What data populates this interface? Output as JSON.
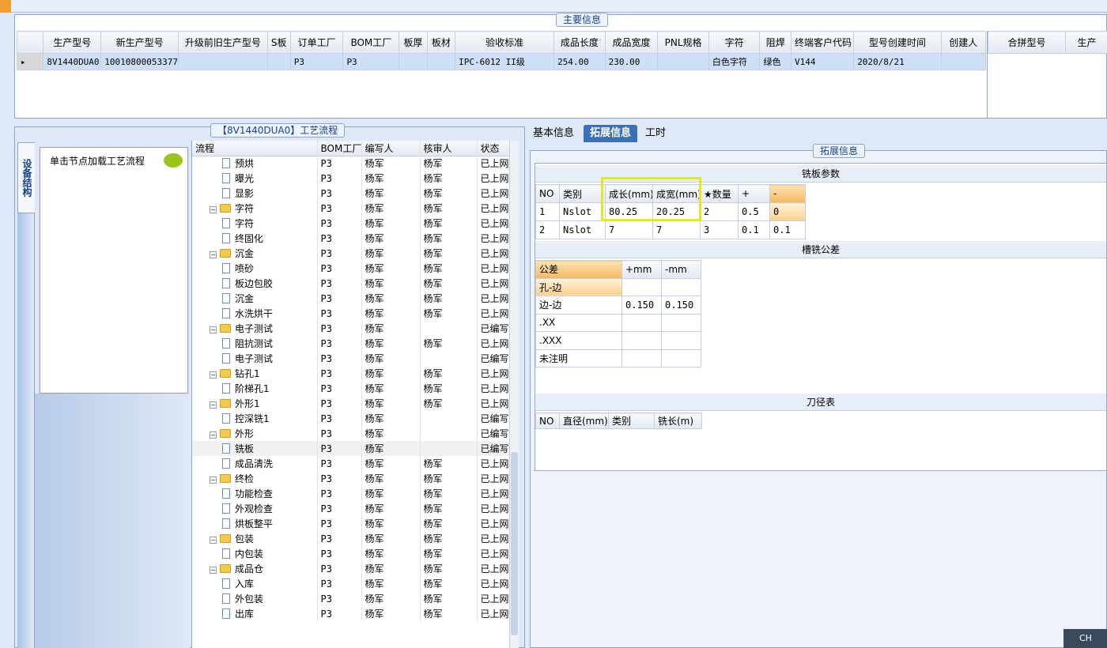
{
  "main_panel": {
    "title": "主要信息",
    "columns": [
      "生产型号",
      "新生产型号",
      "升级前旧生产型号",
      "S板",
      "订单工厂",
      "BOM工厂",
      "板厚",
      "板材",
      "验收标准",
      "成品长度",
      "成品宽度",
      "PNL规格",
      "字符",
      "阻焊",
      "终端客户代码",
      "型号创建时间",
      "创建人"
    ],
    "rows": [
      [
        "8V1440DUA0",
        "10010800053377",
        "",
        "",
        "P3",
        "P3",
        "",
        "",
        "IPC-6012 II级",
        "254.00",
        "230.00",
        "",
        "白色字符",
        "绿色",
        "V144",
        "2020/8/21",
        ""
      ]
    ],
    "combined_columns": [
      "合拼型号",
      "生产"
    ]
  },
  "left_panel": {
    "title": "【8V1440DUA0】工艺流程",
    "vertical_tab": "设备结构",
    "hint": "单击节点加载工艺流程",
    "columns": [
      "流程",
      "BOM工厂",
      "编写人",
      "核审人",
      "状态"
    ],
    "rows": [
      {
        "level": 1,
        "type": "doc",
        "name": "预烘",
        "bom": "P3",
        "writer": "杨军",
        "reviewer": "杨军",
        "status": "已上网"
      },
      {
        "level": 1,
        "type": "doc",
        "name": "曝光",
        "bom": "P3",
        "writer": "杨军",
        "reviewer": "杨军",
        "status": "已上网"
      },
      {
        "level": 1,
        "type": "doc",
        "name": "显影",
        "bom": "P3",
        "writer": "杨军",
        "reviewer": "杨军",
        "status": "已上网"
      },
      {
        "level": 0,
        "type": "folder",
        "name": "字符",
        "bom": "P3",
        "writer": "杨军",
        "reviewer": "杨军",
        "status": "已上网"
      },
      {
        "level": 1,
        "type": "doc",
        "name": "字符",
        "bom": "P3",
        "writer": "杨军",
        "reviewer": "杨军",
        "status": "已上网"
      },
      {
        "level": 1,
        "type": "doc",
        "name": "终固化",
        "bom": "P3",
        "writer": "杨军",
        "reviewer": "杨军",
        "status": "已上网"
      },
      {
        "level": 0,
        "type": "folder",
        "name": "沉金",
        "bom": "P3",
        "writer": "杨军",
        "reviewer": "杨军",
        "status": "已上网"
      },
      {
        "level": 1,
        "type": "doc",
        "name": "喷砂",
        "bom": "P3",
        "writer": "杨军",
        "reviewer": "杨军",
        "status": "已上网"
      },
      {
        "level": 1,
        "type": "doc",
        "name": "板边包胶",
        "bom": "P3",
        "writer": "杨军",
        "reviewer": "杨军",
        "status": "已上网"
      },
      {
        "level": 1,
        "type": "doc",
        "name": "沉金",
        "bom": "P3",
        "writer": "杨军",
        "reviewer": "杨军",
        "status": "已上网"
      },
      {
        "level": 1,
        "type": "doc",
        "name": "水洗烘干",
        "bom": "P3",
        "writer": "杨军",
        "reviewer": "杨军",
        "status": "已上网"
      },
      {
        "level": 0,
        "type": "folder",
        "name": "电子测试",
        "bom": "P3",
        "writer": "杨军",
        "reviewer": "",
        "status": "已编写"
      },
      {
        "level": 1,
        "type": "doc",
        "name": "阻抗测试",
        "bom": "P3",
        "writer": "杨军",
        "reviewer": "杨军",
        "status": "已上网"
      },
      {
        "level": 1,
        "type": "doc",
        "name": "电子测试",
        "bom": "P3",
        "writer": "杨军",
        "reviewer": "",
        "status": "已编写"
      },
      {
        "level": 0,
        "type": "folder",
        "name": "钻孔1",
        "bom": "P3",
        "writer": "杨军",
        "reviewer": "杨军",
        "status": "已上网"
      },
      {
        "level": 1,
        "type": "doc",
        "name": "阶梯孔1",
        "bom": "P3",
        "writer": "杨军",
        "reviewer": "杨军",
        "status": "已上网"
      },
      {
        "level": 0,
        "type": "folder",
        "name": "外形1",
        "bom": "P3",
        "writer": "杨军",
        "reviewer": "杨军",
        "status": "已上网"
      },
      {
        "level": 1,
        "type": "doc",
        "name": "控深铣1",
        "bom": "P3",
        "writer": "杨军",
        "reviewer": "",
        "status": "已编写"
      },
      {
        "level": 0,
        "type": "folder",
        "name": "外形",
        "bom": "P3",
        "writer": "杨军",
        "reviewer": "",
        "status": "已编写"
      },
      {
        "level": 1,
        "type": "doc",
        "name": "铣板",
        "bom": "P3",
        "writer": "杨军",
        "reviewer": "",
        "status": "已编写",
        "selected": true
      },
      {
        "level": 1,
        "type": "doc",
        "name": "成品清洗",
        "bom": "P3",
        "writer": "杨军",
        "reviewer": "杨军",
        "status": "已上网"
      },
      {
        "level": 0,
        "type": "folder",
        "name": "终检",
        "bom": "P3",
        "writer": "杨军",
        "reviewer": "杨军",
        "status": "已上网"
      },
      {
        "level": 1,
        "type": "doc",
        "name": "功能检查",
        "bom": "P3",
        "writer": "杨军",
        "reviewer": "杨军",
        "status": "已上网"
      },
      {
        "level": 1,
        "type": "doc",
        "name": "外观检查",
        "bom": "P3",
        "writer": "杨军",
        "reviewer": "杨军",
        "status": "已上网"
      },
      {
        "level": 1,
        "type": "doc",
        "name": "烘板整平",
        "bom": "P3",
        "writer": "杨军",
        "reviewer": "杨军",
        "status": "已上网"
      },
      {
        "level": 0,
        "type": "folder",
        "name": "包装",
        "bom": "P3",
        "writer": "杨军",
        "reviewer": "杨军",
        "status": "已上网"
      },
      {
        "level": 1,
        "type": "doc",
        "name": "内包装",
        "bom": "P3",
        "writer": "杨军",
        "reviewer": "杨军",
        "status": "已上网"
      },
      {
        "level": 0,
        "type": "folder",
        "name": "成品仓",
        "bom": "P3",
        "writer": "杨军",
        "reviewer": "杨军",
        "status": "已上网"
      },
      {
        "level": 1,
        "type": "doc",
        "name": "入库",
        "bom": "P3",
        "writer": "杨军",
        "reviewer": "杨军",
        "status": "已上网"
      },
      {
        "level": 1,
        "type": "doc",
        "name": "外包装",
        "bom": "P3",
        "writer": "杨军",
        "reviewer": "杨军",
        "status": "已上网"
      },
      {
        "level": 1,
        "type": "doc",
        "name": "出库",
        "bom": "P3",
        "writer": "杨军",
        "reviewer": "杨军",
        "status": "已上网"
      }
    ]
  },
  "right_panel": {
    "tabs": [
      "基本信息",
      "拓展信息",
      "工时"
    ],
    "active_tab": "拓展信息",
    "group_title": "拓展信息",
    "milling": {
      "title": "铣板参数",
      "columns": [
        "NO",
        "类别",
        "成长(mm)",
        "成宽(mm)",
        "★数量",
        "+",
        "-"
      ],
      "rows": [
        [
          "1",
          "Nslot",
          "80.25",
          "20.25",
          "2",
          "0.5",
          "0"
        ],
        [
          "2",
          "Nslot",
          "7",
          "7",
          "3",
          "0.1",
          "0.1"
        ]
      ]
    },
    "tolerance": {
      "title": "槽铣公差",
      "columns": [
        "公差",
        "+mm",
        "-mm"
      ],
      "rows": [
        [
          "孔-边",
          "",
          ""
        ],
        [
          "边-边",
          "0.150",
          "0.150"
        ],
        [
          ".XX",
          "",
          ""
        ],
        [
          ".XXX",
          "",
          ""
        ],
        [
          "未注明",
          "",
          ""
        ]
      ]
    },
    "tool": {
      "title": "刀径表",
      "columns": [
        "NO",
        "直径(mm)",
        "类别",
        "铣长(m)"
      ]
    }
  },
  "status_corner": "CH"
}
